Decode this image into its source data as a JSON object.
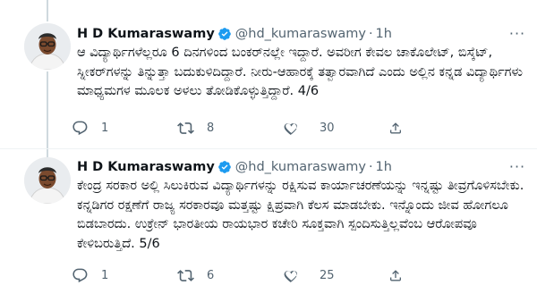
{
  "tweets": [
    {
      "author_name": "H D Kumaraswamy",
      "handle": "@hd_kumaraswamy",
      "separator": "·",
      "time": "1h",
      "text": "ಆ ವಿದ್ಯಾರ್ಥಿಗಳೆಲ್ಲರೂ 6 ದಿನಗಳಿಂದ ಬಂಕರ್‌ನಲ್ಲೇ ಇದ್ದಾರೆ. ಅವರೀಗ ಕೇವಲ ಚಾಕೊಲೇಟ್, ಬಿಸ್ಕೆಟ್, ಸ್ನೀಕರ್‌ಗಳನ್ನು ತಿನ್ನುತ್ತಾ ಬದುಕುಳಿದಿದ್ದಾರೆ. ನೀರು-ಆಹಾರಕ್ಕೆ ತತ್ವಾರವಾಗಿದೆ ಎಂದು ಅಲ್ಲಿನ ಕನ್ನಡ ವಿದ್ಯಾರ್ಥಿಗಳು ಮಾಧ್ಯಮಗಳ ಮೂಲಕ ಅಳಲು ತೋಡಿಕೊಳ್ಳುತ್ತಿದ್ದಾರೆ. 4/6",
      "reply_count": "1",
      "retweet_count": "8",
      "like_count": "30",
      "more": "···"
    },
    {
      "author_name": "H D Kumaraswamy",
      "handle": "@hd_kumaraswamy",
      "separator": "·",
      "time": "1h",
      "text": "ಕೇಂದ್ರ ಸರಕಾರ ಅಲ್ಲಿ ಸಿಲುಕಿರುವ ವಿದ್ಯಾರ್ಥಿಗಳನ್ನು ರಕ್ಷಿಸುವ ಕಾರ್ಯಾಚರಣೆಯನ್ನು ಇನ್ನಷ್ಟು ತೀವ್ರಗೊಳಿಸಬೇಕು. ಕನ್ನಡಿಗರ ರಕ್ಷಣೆಗೆ ರಾಜ್ಯ ಸರಕಾರವೂ ಮತ್ತಷ್ಟು ಕ್ಷಿಪ್ರವಾಗಿ ಕೆಲಸ ಮಾಡಬೇಕು. ಇನ್ನೊಂದು ಜೀವ ಹೋಗಲೂ ಬಿಡಬಾರದು. ಉಕ್ರೇನ್ ಭಾರತೀಯ ರಾಯಭಾರ ಕಚೇರಿ ಸೂಕ್ತವಾಗಿ ಸ್ಪಂದಿಸುತ್ತಿಲ್ಲವೆಂಬ ಆರೋಪವೂ ಕೇಳಿಬರುತ್ತಿದೆ. 5/6",
      "reply_count": "1",
      "retweet_count": "6",
      "like_count": "25",
      "more": "···"
    }
  ],
  "colors": {
    "text_primary": "#0f1419",
    "text_secondary": "#536471",
    "verified_blue": "#1d9bf0",
    "thread_line": "#cfd9de",
    "divider": "#eff3f4"
  },
  "icons": [
    "verified-badge-icon",
    "reply-icon",
    "retweet-icon",
    "like-icon",
    "share-icon",
    "more-icon"
  ]
}
